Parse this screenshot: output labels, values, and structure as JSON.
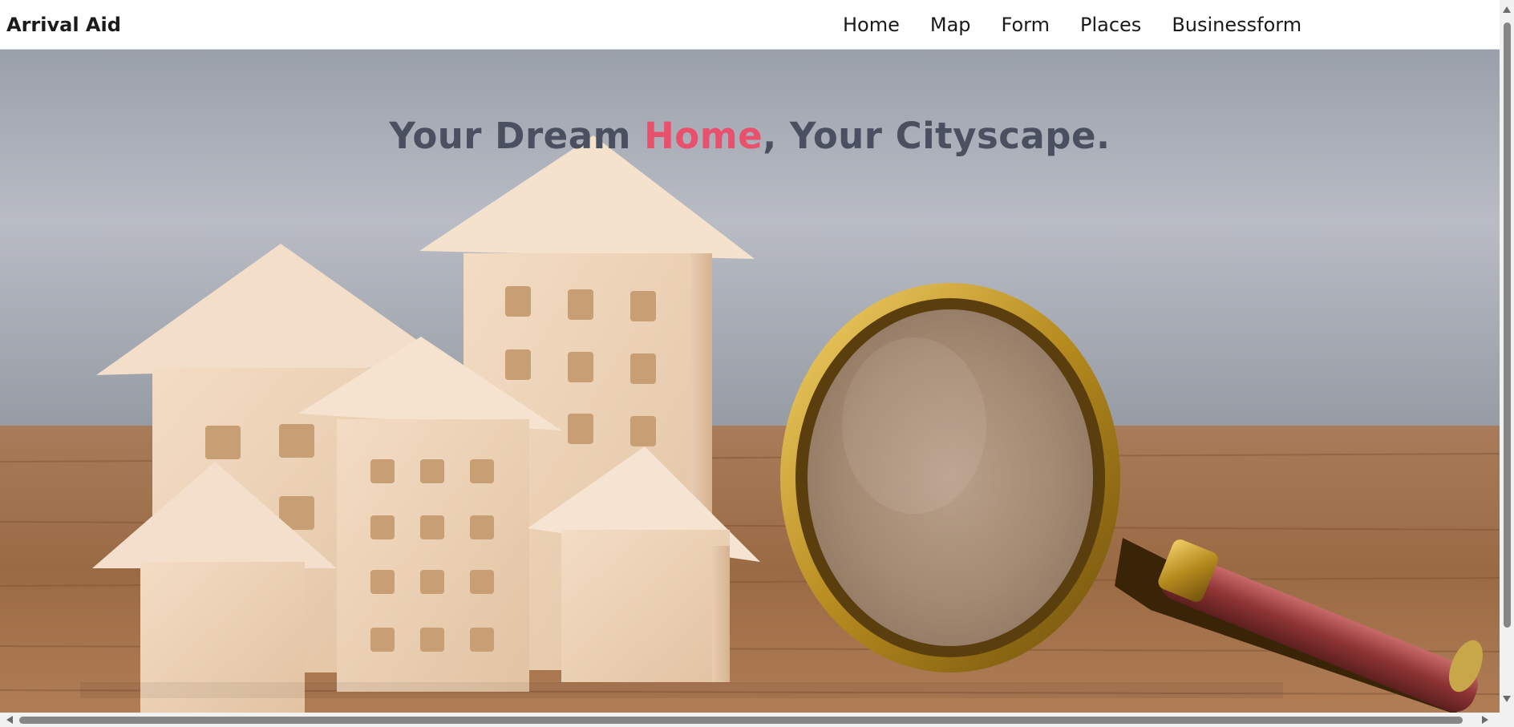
{
  "brand": {
    "title": "Arrival Aid"
  },
  "nav": {
    "items": [
      {
        "label": "Home"
      },
      {
        "label": "Map"
      },
      {
        "label": "Form"
      },
      {
        "label": "Places"
      },
      {
        "label": "Businessform"
      }
    ]
  },
  "hero": {
    "title_before": "Your Dream ",
    "title_accent": "Home",
    "title_after": ", Your Cityscape.",
    "image": "wooden-houses-magnifying-glass-photo"
  },
  "colors": {
    "accent": "#e8506c",
    "title_text": "#4a5060",
    "wall": "#a9aeb8",
    "wood_table": "#9a6a44"
  }
}
